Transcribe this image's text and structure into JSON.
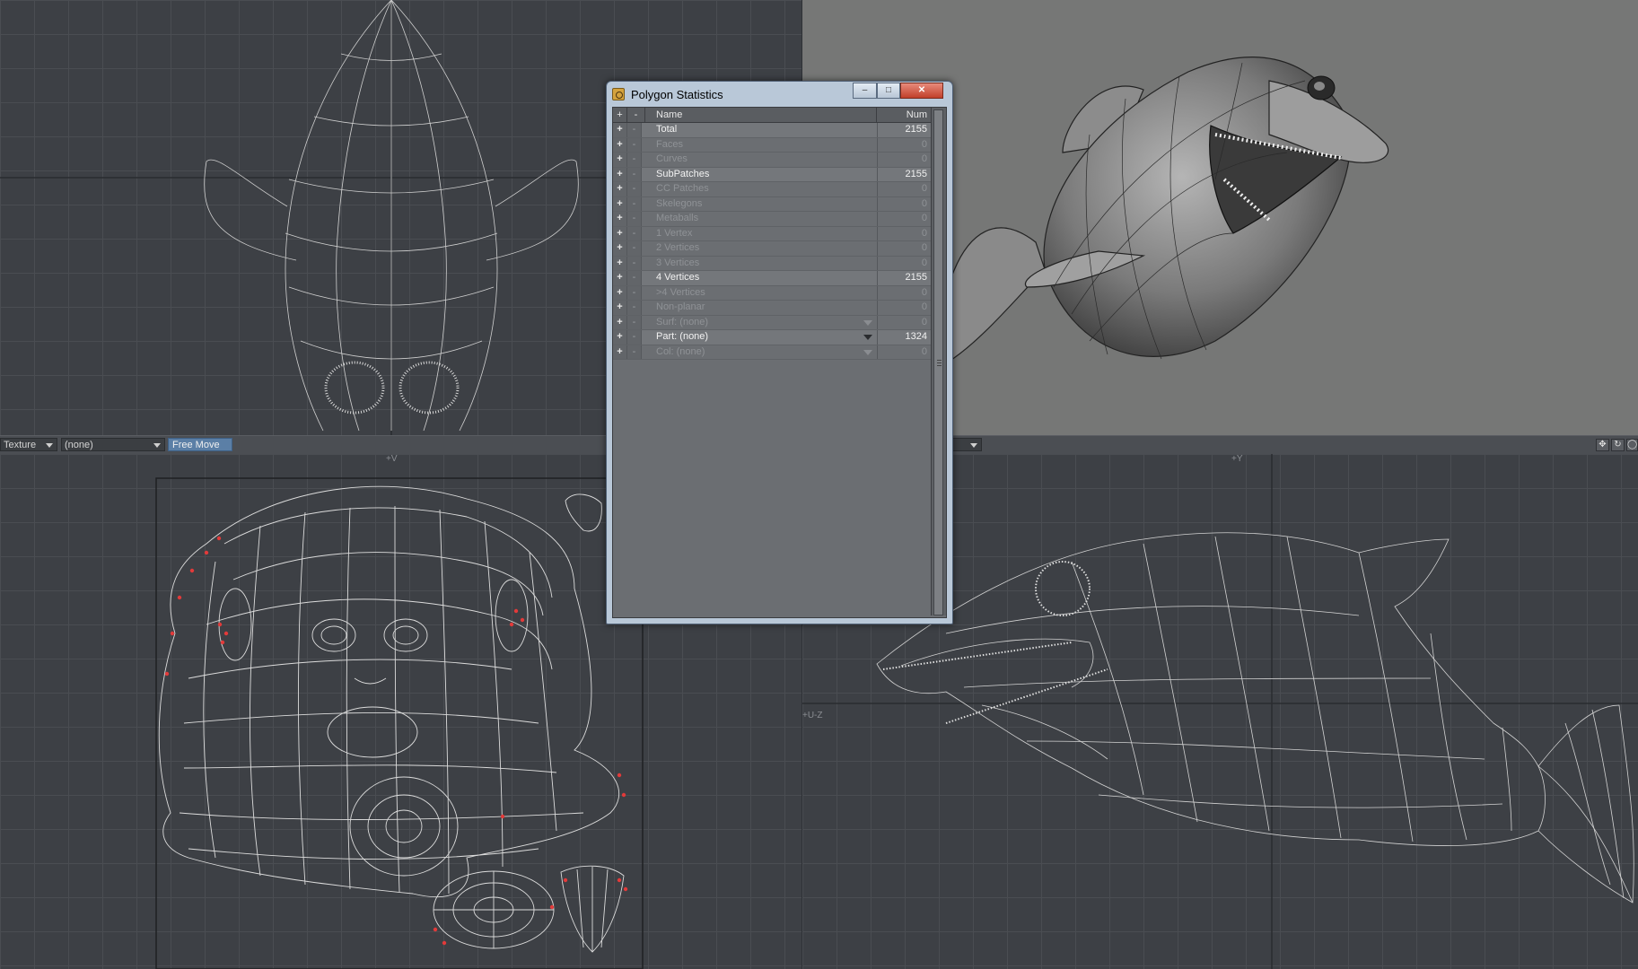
{
  "dialog": {
    "title": "Polygon Statistics",
    "minimize_glyph": "–",
    "maximize_glyph": "□",
    "close_glyph": "✕",
    "columns": {
      "add": "+",
      "remove": "-",
      "name": "Name",
      "num": "Num"
    },
    "rows": [
      {
        "plus": "+",
        "minus": "-",
        "name": "Total",
        "num": "2155",
        "state": "active"
      },
      {
        "plus": "+",
        "minus": "-",
        "name": "Faces",
        "num": "0",
        "state": "dim"
      },
      {
        "plus": "+",
        "minus": "-",
        "name": "Curves",
        "num": "0",
        "state": "dim"
      },
      {
        "plus": "+",
        "minus": "-",
        "name": "SubPatches",
        "num": "2155",
        "state": "active"
      },
      {
        "plus": "+",
        "minus": "-",
        "name": "CC Patches",
        "num": "0",
        "state": "dim"
      },
      {
        "plus": "+",
        "minus": "-",
        "name": "Skelegons",
        "num": "0",
        "state": "dim"
      },
      {
        "plus": "+",
        "minus": "-",
        "name": "Metaballs",
        "num": "0",
        "state": "dim"
      },
      {
        "plus": "+",
        "minus": "-",
        "name": "1 Vertex",
        "num": "0",
        "state": "dim"
      },
      {
        "plus": "+",
        "minus": "-",
        "name": "2 Vertices",
        "num": "0",
        "state": "dim"
      },
      {
        "plus": "+",
        "minus": "-",
        "name": "3 Vertices",
        "num": "0",
        "state": "dim"
      },
      {
        "plus": "+",
        "minus": "-",
        "name": "4 Vertices",
        "num": "2155",
        "state": "active"
      },
      {
        "plus": "+",
        "minus": "-",
        "name": ">4 Vertices",
        "num": "0",
        "state": "dim"
      },
      {
        "plus": "+",
        "minus": "-",
        "name": "Non-planar",
        "num": "0",
        "state": "dim"
      },
      {
        "plus": "+",
        "minus": "-",
        "name": "Surf: (none)",
        "num": "0",
        "state": "dim",
        "dropdown": true
      },
      {
        "plus": "+",
        "minus": "-",
        "name": "Part: (none)",
        "num": "1324",
        "state": "active",
        "dropdown": true
      },
      {
        "plus": "+",
        "minus": "-",
        "name": "Col: (none)",
        "num": "0",
        "state": "dim",
        "dropdown": true
      }
    ]
  },
  "uv_viewport": {
    "map_type": "Texture",
    "map_name": "(none)",
    "tool": "Free Move",
    "axis_label": "+V"
  },
  "side_viewport": {
    "axis_top": "+Y",
    "axis_left": "+U-Z"
  },
  "colors": {
    "viewport_bg": "#3d4045",
    "grid_line": "#4a4d52",
    "perspective_bg": "#767776",
    "wire": "#d6d6d6",
    "selected_point": "#e23a3a",
    "tool_active": "#5b7fa6"
  },
  "icons": [
    "move-view-icon",
    "rotate-view-icon",
    "zoom-view-icon",
    "window-app-icon"
  ]
}
